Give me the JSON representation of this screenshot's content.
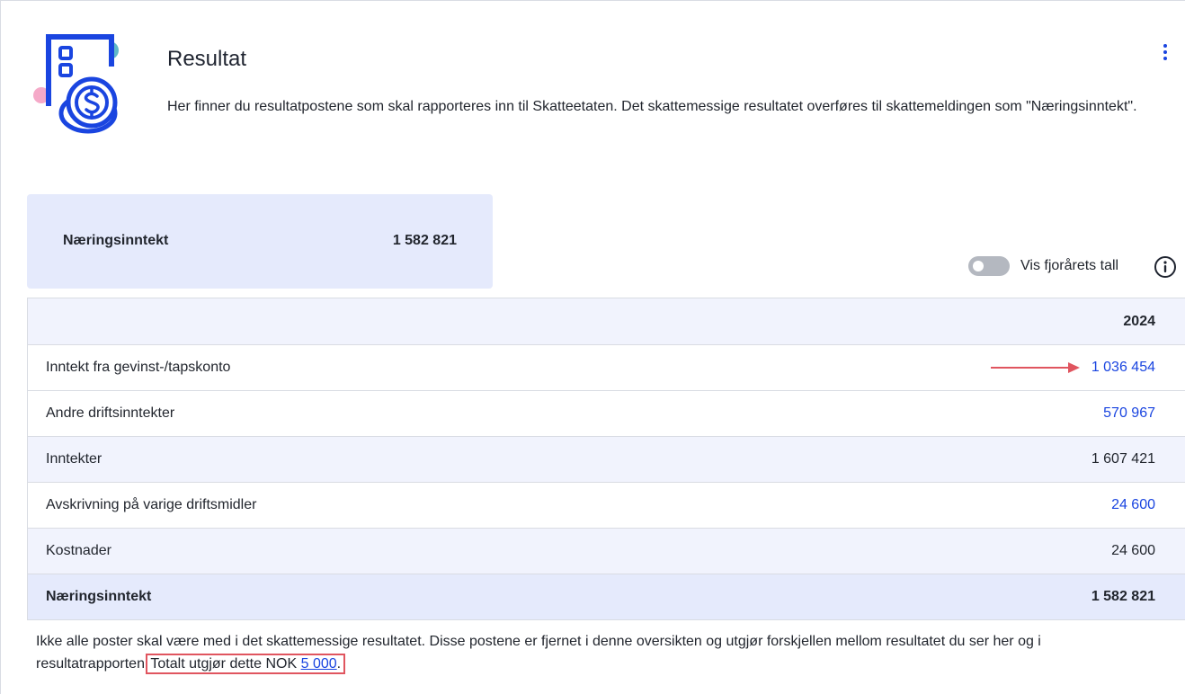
{
  "header": {
    "title": "Resultat",
    "description": "Her finner du resultatpostene som skal rapporteres inn til Skatteetaten. Det skattemessige resultatet overføres til skattemeldingen som \"Næringsinntekt\"."
  },
  "summary": {
    "label": "Næringsinntekt",
    "value": "1 582 821"
  },
  "toggle": {
    "label": "Vis fjorårets tall",
    "on": false
  },
  "table": {
    "year_header": "2024",
    "rows": [
      {
        "label": "Inntekt fra gevinst-/tapskonto",
        "value": "1 036 454"
      },
      {
        "label": "Andre driftsinntekter",
        "value": "570 967"
      },
      {
        "label": "Inntekter",
        "value": "1 607 421"
      },
      {
        "label": "Avskrivning på varige driftsmidler",
        "value": "24 600"
      },
      {
        "label": "Kostnader",
        "value": "24 600"
      },
      {
        "label": "Næringsinntekt",
        "value": "1 582 821"
      }
    ]
  },
  "footnote": {
    "text": "Ikke alle poster skal være med i det skattemessige resultatet. Disse postene er fjernet i denne oversikten og utgjør forskjellen mellom resultatet du ser her og i resultatrapporten.",
    "highlight_prefix": "Totalt utgjør dette NOK ",
    "highlight_link": "5 000",
    "highlight_suffix": "."
  },
  "colors": {
    "accent": "#1a45e0",
    "summary_bg": "#e5eafc",
    "annotation_red": "#e0555f"
  },
  "icons": [
    "building-coin-icon",
    "more-vertical-icon",
    "info-icon",
    "arrow-right-annotation"
  ]
}
